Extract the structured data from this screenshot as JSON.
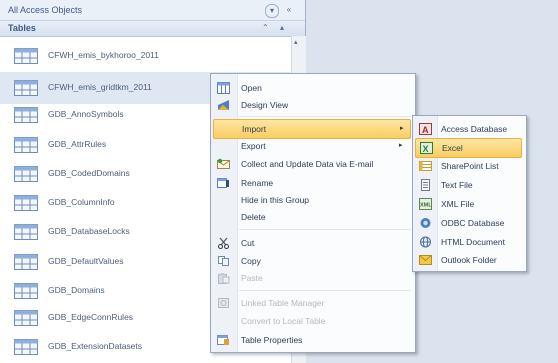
{
  "nav": {
    "title": "All Access Objects",
    "group_label": "Tables",
    "items": [
      {
        "label": "CFWH_emis_bykhoroo_2011"
      },
      {
        "label": "CFWH_emis_gridtkm_2011"
      },
      {
        "label": "GDB_AnnoSymbols"
      },
      {
        "label": "GDB_AttrRules"
      },
      {
        "label": "GDB_CodedDomains"
      },
      {
        "label": "GDB_ColumnInfo"
      },
      {
        "label": "GDB_DatabaseLocks"
      },
      {
        "label": "GDB_DefaultValues"
      },
      {
        "label": "GDB_Domains"
      },
      {
        "label": "GDB_EdgeConnRules"
      },
      {
        "label": "GDB_ExtensionDatasets"
      }
    ]
  },
  "context_menu": {
    "items": [
      {
        "label": "Open",
        "icon": "open-table-icon"
      },
      {
        "label": "Design View",
        "icon": "design-view-icon"
      },
      {
        "label": "Import",
        "icon": ""
      },
      {
        "label": "Export",
        "icon": ""
      },
      {
        "label": "Collect and Update Data via E-mail",
        "icon": "email-icon"
      },
      {
        "label": "Rename",
        "icon": "rename-icon"
      },
      {
        "label": "Hide in this Group",
        "icon": ""
      },
      {
        "label": "Delete",
        "icon": ""
      },
      {
        "label": "Cut",
        "icon": "scissors-icon"
      },
      {
        "label": "Copy",
        "icon": "copy-icon"
      },
      {
        "label": "Paste",
        "icon": "paste-icon"
      },
      {
        "label": "Linked Table Manager",
        "icon": "linked-table-icon"
      },
      {
        "label": "Convert to Local Table",
        "icon": ""
      },
      {
        "label": "Table Properties",
        "icon": "properties-icon"
      }
    ]
  },
  "import_submenu": {
    "items": [
      {
        "label": "Access Database",
        "icon": "access-icon"
      },
      {
        "label": "Excel",
        "icon": "excel-icon"
      },
      {
        "label": "SharePoint List",
        "icon": "sharepoint-icon"
      },
      {
        "label": "Text File",
        "icon": "text-file-icon"
      },
      {
        "label": "XML File",
        "icon": "xml-icon"
      },
      {
        "label": "ODBC Database",
        "icon": "odbc-icon"
      },
      {
        "label": "HTML Document",
        "icon": "html-icon"
      },
      {
        "label": "Outlook Folder",
        "icon": "outlook-icon"
      }
    ]
  }
}
